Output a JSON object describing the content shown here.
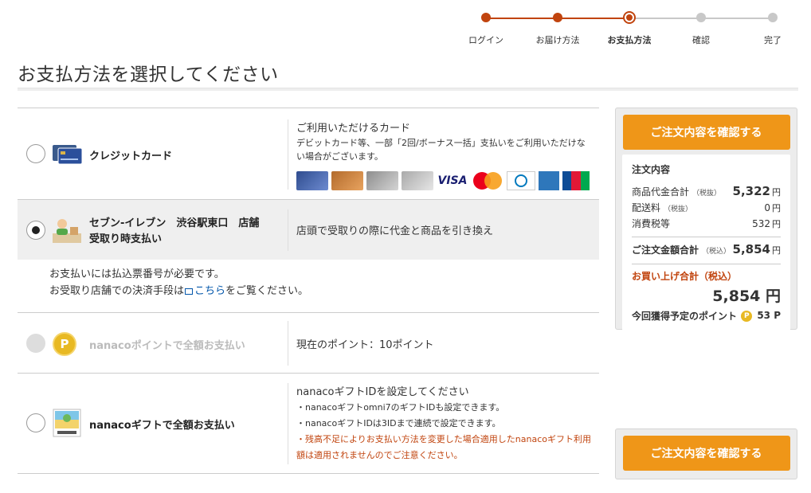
{
  "stepper": {
    "steps": [
      {
        "label": "ログイン",
        "state": "done"
      },
      {
        "label": "お届け方法",
        "state": "done"
      },
      {
        "label": "お支払方法",
        "state": "current"
      },
      {
        "label": "確認",
        "state": "todo"
      },
      {
        "label": "完了",
        "state": "todo"
      }
    ],
    "accent": "#c1440e"
  },
  "page_title": "お支払方法を選択してください",
  "payments": {
    "credit": {
      "name": "クレジットカード",
      "desc_title": "ご利用いただけるカード",
      "desc_body": "デビットカード等、一部「2回/ボーナス一括」支払いをご利用いただけない場合がございます。",
      "brands": {
        "visa": "VISA",
        "master": "MasterCard",
        "diners": "Diners Club",
        "amex": "AMEX",
        "jcb": "JCB"
      }
    },
    "seven": {
      "name_line1": "セブン-イレブン　渋谷駅東口　店舗",
      "name_line2": "受取り時支払い",
      "desc": "店頭で受取りの際に代金と商品を引き換え",
      "note_line1": "お支払いには払込票番号が必要です。",
      "note_line2_pre": "お受取り店舗での決済手段は",
      "note_link": "こちら",
      "note_line2_post": "をご覧ください。"
    },
    "nanaco_point": {
      "name": "nanacoポイントで全額お支払い",
      "desc": "現在のポイント：10ポイント"
    },
    "nanaco_gift": {
      "name": "nanacoギフトで全額お支払い",
      "desc_title": "nanacoギフトIDを設定してください",
      "line1": "・nanacoギフトomni7のギフトIDも設定できます。",
      "line2": "・nanacoギフトIDは3IDまで連続で設定できます。",
      "line3": "・残高不足によりお支払い方法を変更した場合適用したnanacoギフト利用額は適用されませんのでご注意ください。"
    }
  },
  "sidebar": {
    "confirm_label": "ご注文内容を確認する",
    "summary_title": "注文内容",
    "subtotal_label": "商品代金合計",
    "subtotal_tax": "（税抜）",
    "subtotal_value": "5,322",
    "shipping_label": "配送料",
    "shipping_tax": "（税抜）",
    "shipping_value": "0",
    "ctax_label": "消費税等",
    "ctax_value": "532",
    "total_label": "ご注文金額合計",
    "total_tax": "（税込）",
    "total_value": "5,854",
    "yen": "円",
    "grand_label": "お買い上げ合計（税込）",
    "grand_value": "5,854 円",
    "points_label": "今回獲得予定のポイント",
    "points_value": "53 P",
    "coin_letter": "P"
  },
  "colors": {
    "accent": "#c1440e",
    "button": "#ef9618",
    "link": "#0055aa"
  }
}
